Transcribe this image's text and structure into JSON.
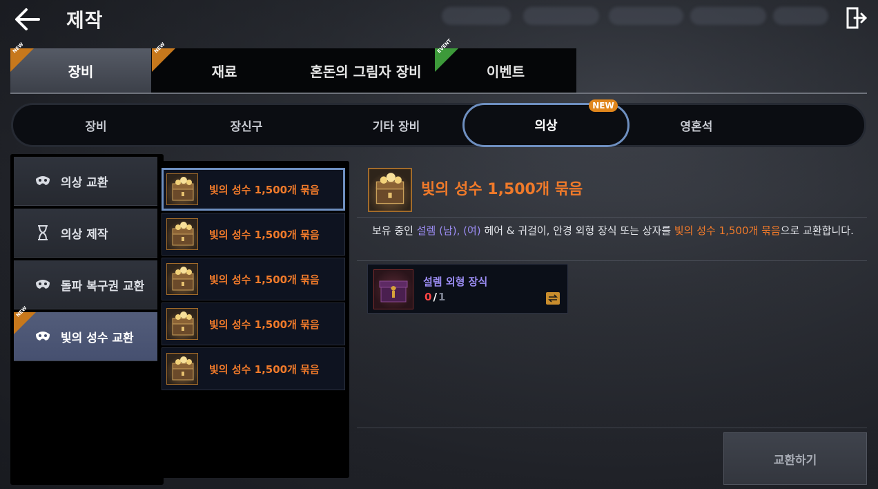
{
  "header": {
    "title": "제작",
    "back_icon": "back-arrow-icon",
    "exit_icon": "exit-icon"
  },
  "main_tabs": [
    {
      "label": "장비",
      "badge": "NEW",
      "active": true
    },
    {
      "label": "재료",
      "badge": "NEW",
      "active": false
    },
    {
      "label": "혼돈의 그림자 장비",
      "badge": "",
      "active": false
    },
    {
      "label": "이벤트",
      "badge": "EVENT",
      "active": false
    }
  ],
  "sub_tabs": [
    {
      "label": "장비",
      "active": false
    },
    {
      "label": "장신구",
      "active": false
    },
    {
      "label": "기타 장비",
      "active": false
    },
    {
      "label": "의상",
      "active": true,
      "badge": "NEW"
    },
    {
      "label": "영혼석",
      "active": false
    }
  ],
  "left_menu": [
    {
      "label": "의상 교환",
      "icon": "mask-icon",
      "active": false
    },
    {
      "label": "의상 제작",
      "icon": "hourglass-icon",
      "active": false
    },
    {
      "label": "돌파 복구권 교환",
      "icon": "mask-icon",
      "active": false
    },
    {
      "label": "빛의 성수 교환",
      "icon": "mask-icon",
      "active": true,
      "badge": "NEW"
    }
  ],
  "item_list": [
    {
      "label": "빛의 성수 1,500개 묶음",
      "selected": true
    },
    {
      "label": "빛의 성수 1,500개 묶음",
      "selected": false
    },
    {
      "label": "빛의 성수 1,500개 묶음",
      "selected": false
    },
    {
      "label": "빛의 성수 1,500개 묶음",
      "selected": false
    },
    {
      "label": "빛의 성수 1,500개 묶음",
      "selected": false
    }
  ],
  "detail": {
    "title": "빛의 성수 1,500개 묶음",
    "desc_pre": "보유 중인 ",
    "desc_hl1": "설렘 (남), (여)",
    "desc_mid": " 헤어 & 귀걸이, 안경 외형 장식 또는 상자를 ",
    "desc_hl2": "빛의 성수 1,500개 묶음",
    "desc_post": "으로 교환합니다."
  },
  "material": {
    "name": "설렘 외형 장식",
    "have": "0",
    "separator": "/",
    "need": "1",
    "swap_icon": "swap-icon"
  },
  "exchange_button": {
    "label": "교환하기"
  },
  "colors": {
    "accent_orange": "#f07a2a",
    "accent_purple": "#9b8cf2",
    "selected_border": "#6e8fc0",
    "badge_orange": "#c7781c",
    "badge_green": "#3d9a3a"
  }
}
